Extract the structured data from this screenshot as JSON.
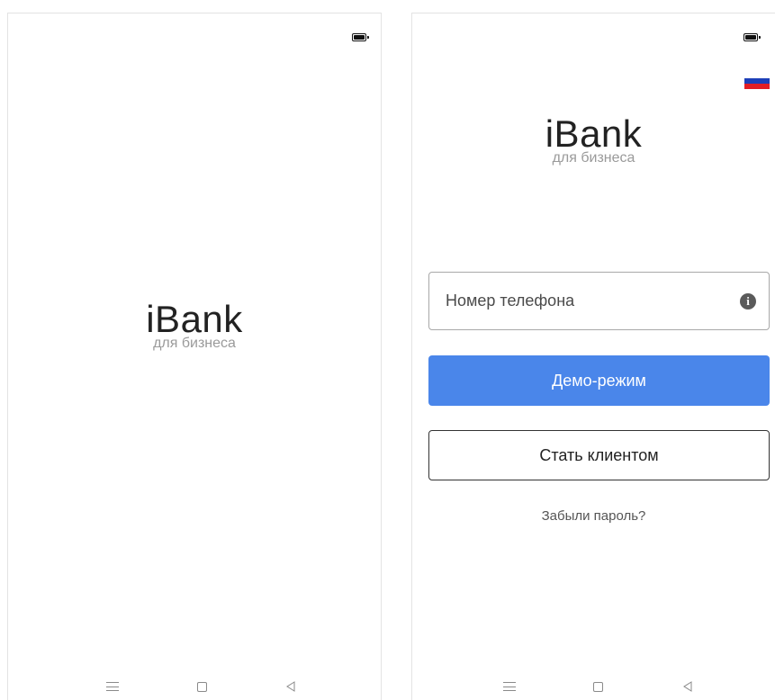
{
  "splash": {
    "brand": "iBank",
    "tagline": "для бизнеса"
  },
  "login": {
    "brand": "iBank",
    "tagline": "для бизнеса",
    "language_flag": "russia-flag-icon",
    "phone_placeholder": "Номер телефона",
    "info_icon": "i",
    "demo_button": "Демо-режим",
    "become_client_button": "Стать клиентом",
    "forgot_password": "Забыли пароль?"
  },
  "colors": {
    "primary": "#4a86ea",
    "text": "#222222",
    "muted": "#9a9a9a"
  },
  "nav_icons": [
    "menu-icon",
    "home-icon",
    "back-icon"
  ]
}
